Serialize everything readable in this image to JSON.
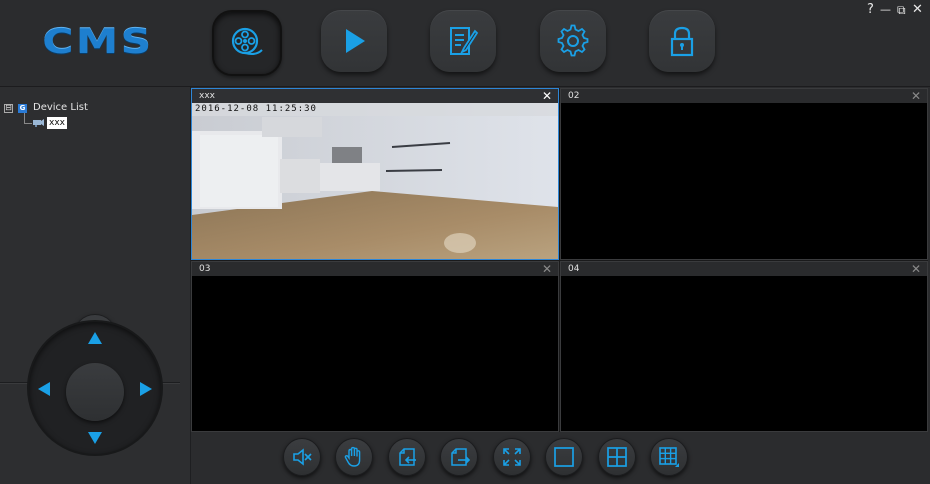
{
  "app": {
    "logo_text": "CMS",
    "accent_color": "#1aa0e6",
    "window_controls": {
      "help": "?",
      "minimize": "—",
      "restore": "⧉",
      "close": "✕"
    }
  },
  "nav": {
    "buttons": [
      {
        "icon": "film-reel-icon",
        "active": true
      },
      {
        "icon": "play-icon",
        "active": false
      },
      {
        "icon": "edit-document-icon",
        "active": false
      },
      {
        "icon": "gear-icon",
        "active": false
      },
      {
        "icon": "lock-icon",
        "active": false
      }
    ]
  },
  "sidebar": {
    "tree": {
      "expander": "⊟",
      "root_icon_letter": "G",
      "root_label": "Device List",
      "device_label": "xxx"
    },
    "add_button_label": "+"
  },
  "ptz": {
    "up": "up-arrow-icon",
    "down": "down-arrow-icon",
    "left": "left-arrow-icon",
    "right": "right-arrow-icon"
  },
  "panes": [
    {
      "title": "xxx",
      "close": "✕",
      "selected": true,
      "osd": "2016-12-08 11:25:30"
    },
    {
      "title": "02",
      "close": "✕",
      "selected": false
    },
    {
      "title": "03",
      "close": "✕",
      "selected": false
    },
    {
      "title": "04",
      "close": "✕",
      "selected": false
    }
  ],
  "toolbar": {
    "buttons": [
      "mute-icon",
      "hand-icon",
      "import-icon",
      "export-icon",
      "fullscreen-icon",
      "single-layout-icon",
      "quad-layout-icon",
      "multi-layout-icon"
    ]
  }
}
